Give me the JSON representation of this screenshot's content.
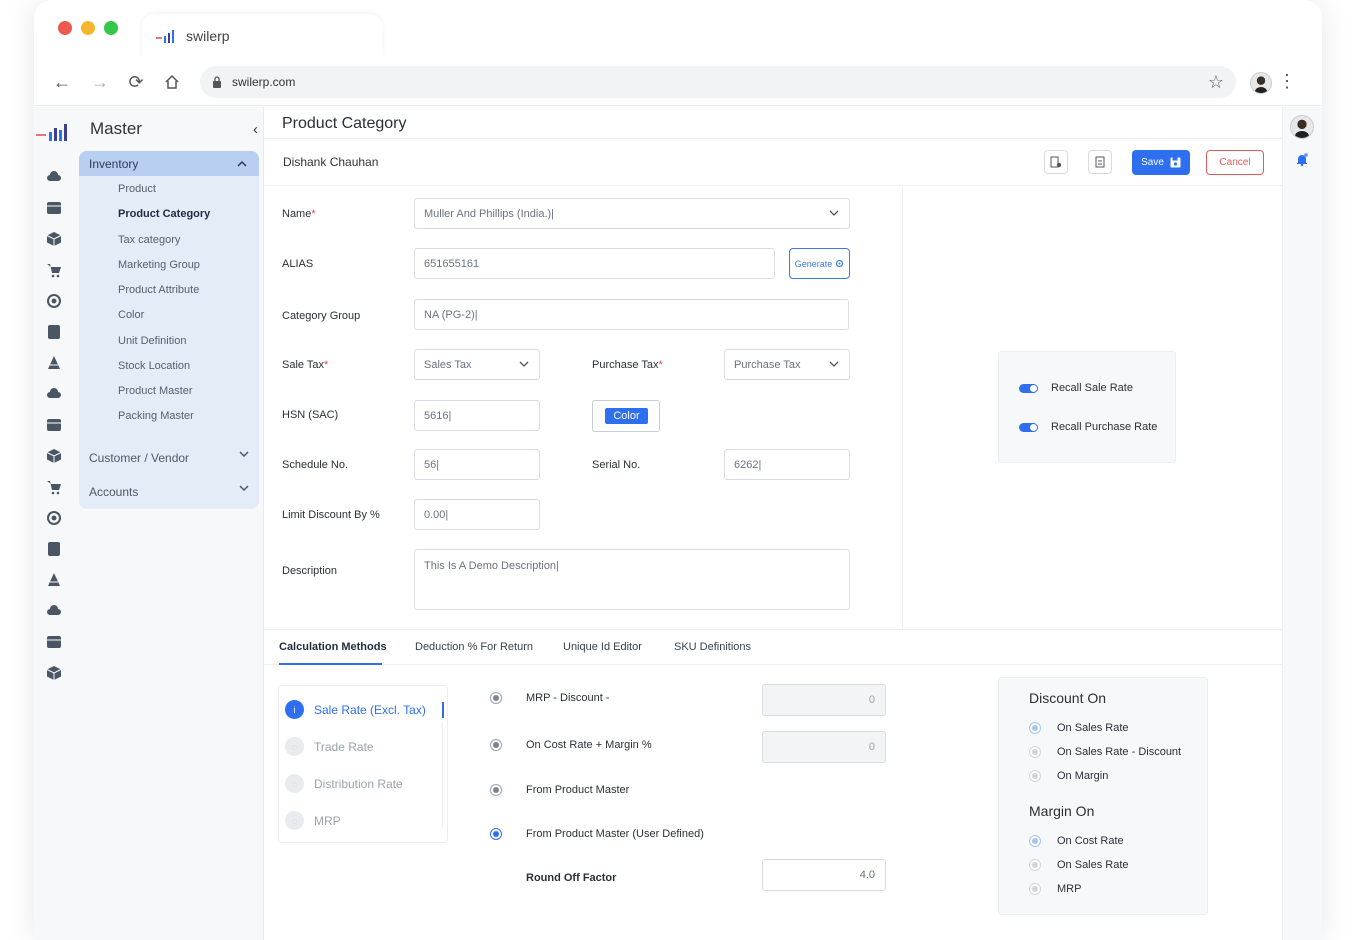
{
  "browser": {
    "tab_title": "swilerp",
    "url": "swilerp.com",
    "traffic_colors": [
      "#ee5a52",
      "#f5b52f",
      "#34c749"
    ]
  },
  "sidebar": {
    "title": "Master",
    "group": {
      "label": "Inventory",
      "items": [
        {
          "label": "Product",
          "active": false
        },
        {
          "label": "Product Category",
          "active": true
        },
        {
          "label": "Tax category",
          "active": false
        },
        {
          "label": "Marketing Group",
          "active": false
        },
        {
          "label": "Product Attribute",
          "active": false
        },
        {
          "label": "Color",
          "active": false
        },
        {
          "label": "Unit Definition",
          "active": false
        },
        {
          "label": "Stock Location",
          "active": false
        },
        {
          "label": "Product Master",
          "active": false
        },
        {
          "label": "Packing Master",
          "active": false
        }
      ]
    },
    "collapsed_groups": [
      {
        "label": "Customer / Vendor"
      },
      {
        "label": "Accounts"
      }
    ]
  },
  "page": {
    "title": "Product Category",
    "user": "Dishank Chauhan",
    "save_label": "Save",
    "cancel_label": "Cancel"
  },
  "form": {
    "name": {
      "label": "Name",
      "value": "Muller And Phillips (India.)|"
    },
    "alias": {
      "label": "ALIAS",
      "value": "651655161",
      "generate_label": "Generate"
    },
    "category_group": {
      "label": "Category Group",
      "value": "NA (PG-2)|"
    },
    "sale_tax": {
      "label": "Sale Tax",
      "value": "Sales Tax"
    },
    "purchase_tax": {
      "label": "Purchase Tax",
      "value": "Purchase Tax"
    },
    "hsn": {
      "label": "HSN (SAC)",
      "value": "5616|"
    },
    "color_button": "Color",
    "schedule": {
      "label": "Schedule No.",
      "value": "56|"
    },
    "serial": {
      "label": "Serial No.",
      "value": "6262|"
    },
    "limit_discount": {
      "label": "Limit Discount By %",
      "value": "0.00|"
    },
    "description": {
      "label": "Description",
      "value": "This Is A Demo Description|"
    }
  },
  "recall": {
    "sale": {
      "label": "Recall Sale Rate",
      "on": true
    },
    "purchase": {
      "label": "Recall Purchase Rate",
      "on": true
    }
  },
  "tabs": [
    {
      "label": "Calculation Methods",
      "active": true
    },
    {
      "label": "Deduction % For Return",
      "active": false
    },
    {
      "label": "Unique Id Editor",
      "active": false
    },
    {
      "label": "SKU Definitions",
      "active": false
    }
  ],
  "rates": [
    {
      "label": "Sale Rate (Excl. Tax)",
      "active": true
    },
    {
      "label": "Trade Rate",
      "active": false
    },
    {
      "label": "Distribution Rate",
      "active": false
    },
    {
      "label": "MRP",
      "active": false
    }
  ],
  "methods": [
    {
      "label": "MRP - Discount -",
      "value": "0",
      "selected": false
    },
    {
      "label": "On Cost Rate + Margin %",
      "value": "0",
      "selected": false
    },
    {
      "label": "From Product Master",
      "selected": false
    },
    {
      "label": "From Product Master (User Defined)",
      "selected": true
    }
  ],
  "round_off": {
    "label": "Round Off Factor",
    "value": "4.0"
  },
  "discount_on": {
    "title": "Discount On",
    "options": [
      "On Sales Rate",
      "On Sales Rate - Discount",
      "On Margin"
    ]
  },
  "margin_on": {
    "title": "Margin On",
    "options": [
      "On Cost Rate",
      "On Sales Rate",
      "MRP"
    ]
  },
  "colors": {
    "accent": "#2e6ff0",
    "danger": "#e25a5a",
    "nav_active": "#b8cff1"
  }
}
